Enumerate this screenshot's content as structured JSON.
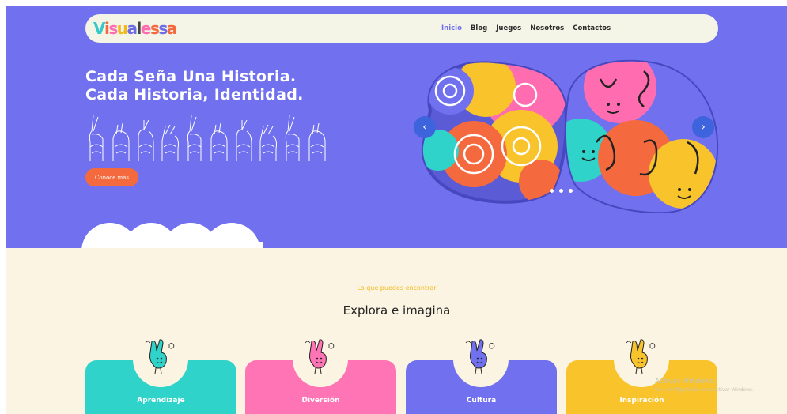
{
  "brand": {
    "logo_letters": [
      "V",
      "i",
      "s",
      "u",
      "a",
      "l",
      "e",
      "s",
      "s",
      "a"
    ],
    "logo_colors": [
      "#35c9c9",
      "#f46a3e",
      "#ff6db0",
      "#f2b91d",
      "#6d6be6",
      "#444444",
      "#ff6db0",
      "#f46a3e",
      "#6d6be6",
      "#f46a3e"
    ]
  },
  "nav": {
    "items": [
      {
        "label": "Inicio",
        "active": true
      },
      {
        "label": "Blog",
        "active": false
      },
      {
        "label": "Juegos",
        "active": false
      },
      {
        "label": "Nosotros",
        "active": false
      },
      {
        "label": "Contactos",
        "active": false
      }
    ]
  },
  "hero": {
    "title": "Cada Seña Una Historia. Cada Historia, Identidad.",
    "cta_label": "Conoce más",
    "sign_hands": 10
  },
  "carousel": {
    "prev_label": "‹",
    "next_label": "›",
    "slides": 3,
    "active_slide": 0
  },
  "section": {
    "eyebrow": "Lo que puedes encontrar",
    "title": "Explora e imagina"
  },
  "cards": [
    {
      "label": "Aprendizaje",
      "color": "#2fd3c9",
      "hand_color": "#2fd3c9"
    },
    {
      "label": "Diversión",
      "color": "#ff74b5",
      "hand_color": "#ff74b5"
    },
    {
      "label": "Cultura",
      "color": "#7170ee",
      "hand_color": "#7170ee"
    },
    {
      "label": "Inspiración",
      "color": "#f9c42b",
      "hand_color": "#f9c42b"
    }
  ],
  "watermark": {
    "line1": "Activar Windows",
    "line2": "Ve a Configuración para activar Windows."
  },
  "colors": {
    "hero_bg": "#7170ee",
    "section_bg": "#fbf4e2",
    "accent": "#f46a3e"
  }
}
